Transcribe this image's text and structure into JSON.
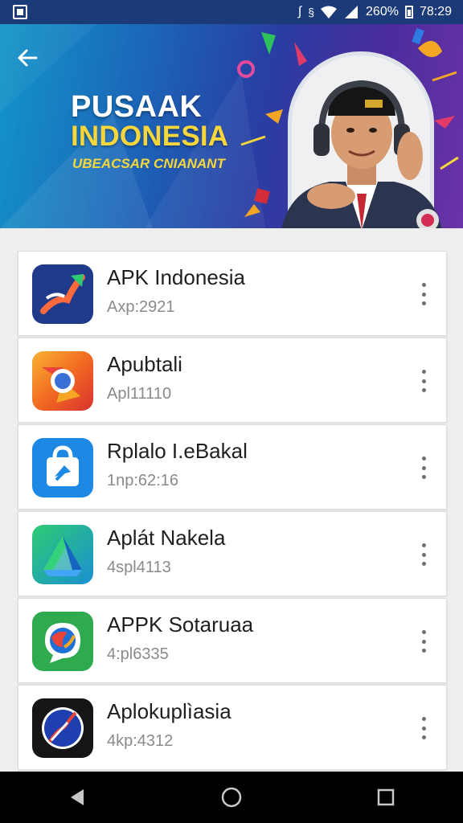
{
  "status_bar": {
    "battery_text": "260%",
    "time": "78:29",
    "icons": [
      "notification-icon",
      "bluetooth-icon",
      "wifi-icon",
      "signal-icon",
      "battery-icon"
    ]
  },
  "banner": {
    "title_line1": "PUSAAK",
    "title_line2": "INDONESIA",
    "subtitle": "UBEACSAR CNIANANT",
    "back_icon": "arrow-left-icon"
  },
  "apps": [
    {
      "name": "APK Indonesia",
      "subtitle": "Axp:2921",
      "icon": "arrow-trend-icon"
    },
    {
      "name": "Apubtali",
      "subtitle": "Apl11110",
      "icon": "chrome-like-icon"
    },
    {
      "name": "Rplalo I.eBakal",
      "subtitle": "1np:62:16",
      "icon": "shopping-bag-icon"
    },
    {
      "name": "Aplát Nakela",
      "subtitle": "4spl4113",
      "icon": "drive-like-icon"
    },
    {
      "name": "APPK Sotaruaa",
      "subtitle": "4:pl6335",
      "icon": "chat-globe-icon"
    },
    {
      "name": "Aplokuplìasia",
      "subtitle": "4kp:4312",
      "icon": "compass-icon"
    }
  ],
  "nav": [
    "back-icon",
    "home-icon",
    "recents-icon"
  ],
  "colors": {
    "status_bar": "#1b3a78",
    "banner_yellow": "#f6d63a",
    "list_bg": "#eeeeee",
    "nav_bar": "#000000"
  }
}
